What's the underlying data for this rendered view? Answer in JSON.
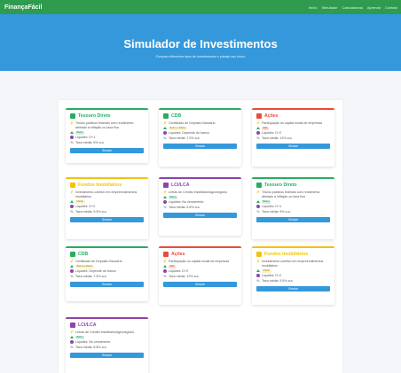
{
  "navbar": {
    "brand": "FinançaFácil",
    "links": [
      "Início",
      "Simulador",
      "Calculadoras",
      "Aprenda",
      "Contato"
    ]
  },
  "hero": {
    "title": "Simulador de Investimentos",
    "subtitle": "Compare diferentes tipos de investimentos e planeje seu futuro"
  },
  "colors": {
    "navbar": "#2e9b4e",
    "hero": "#3498db",
    "button": "#3498db",
    "tesouro": "#27ae60",
    "cdb": "#27ae60",
    "acoes": "#e74c3c",
    "fii": "#f1c40f",
    "lci": "#8e44ad"
  },
  "cards": [
    {
      "title": "Tesouro Direto",
      "theme": "tesouro",
      "desc": "Títulos públicos federais com rendimento atrelado à inflação ou taxa fixa",
      "risk": "Baixo",
      "liquidity": "Liquidez: D+1",
      "rate": "Taxa média: 6% a.a.",
      "button": "Simular"
    },
    {
      "title": "CDB",
      "theme": "cdb",
      "desc": "Certificado de Depósito Bancário",
      "risk": "Baixo a Médio",
      "liquidity": "Liquidez: Depende do banco",
      "rate": "Taxa média: 7.5% a.a.",
      "button": "Simular"
    },
    {
      "title": "Ações",
      "theme": "acoes",
      "desc": "Participação no capital social de empresas",
      "risk": "Alto",
      "liquidity": "Liquidez: D+2",
      "rate": "Taxa média: 12% a.a.",
      "button": "Simular"
    },
    {
      "title": "Fundos Imobiliários",
      "theme": "fii",
      "desc": "Investimento coletivo em empreendimentos imobiliários",
      "risk": "Médio",
      "liquidity": "Liquidez: D+2",
      "rate": "Taxa média: 9.5% a.a.",
      "button": "Simular"
    },
    {
      "title": "LCI/LCA",
      "theme": "lci",
      "desc": "Letras de Crédito Imobiliário/Agronegócio",
      "risk": "Baixo",
      "liquidity": "Liquidez: No vencimento",
      "rate": "Taxa média: 6.8% a.a.",
      "button": "Simular"
    },
    {
      "title": "Tesouro Direto",
      "theme": "tesouro",
      "desc": "Títulos públicos federais com rendimento atrelado à inflação ou taxa fixa",
      "risk": "Baixo",
      "liquidity": "Liquidez: D+1",
      "rate": "Taxa média: 6% a.a.",
      "button": "Simular"
    },
    {
      "title": "CDB",
      "theme": "cdb",
      "desc": "Certificado de Depósito Bancário",
      "risk": "Baixo a Médio",
      "liquidity": "Liquidez: Depende do banco",
      "rate": "Taxa média: 7.5% a.a.",
      "button": "Simular"
    },
    {
      "title": "Ações",
      "theme": "acoes",
      "desc": "Participação no capital social de empresas",
      "risk": "Alto",
      "liquidity": "Liquidez: D+2",
      "rate": "Taxa média: 12% a.a.",
      "button": "Simular"
    },
    {
      "title": "Fundos Imobiliários",
      "theme": "fii",
      "desc": "Investimento coletivo em empreendimentos imobiliários",
      "risk": "Médio",
      "liquidity": "Liquidez: D+2",
      "rate": "Taxa média: 9.5% a.a.",
      "button": "Simular"
    },
    {
      "title": "LCI/LCA",
      "theme": "lci",
      "desc": "Letras de Crédito Imobiliário/Agronegócio",
      "risk": "Baixo",
      "liquidity": "Liquidez: No vencimento",
      "rate": "Taxa média: 6.8% a.a.",
      "button": "Simular"
    }
  ]
}
